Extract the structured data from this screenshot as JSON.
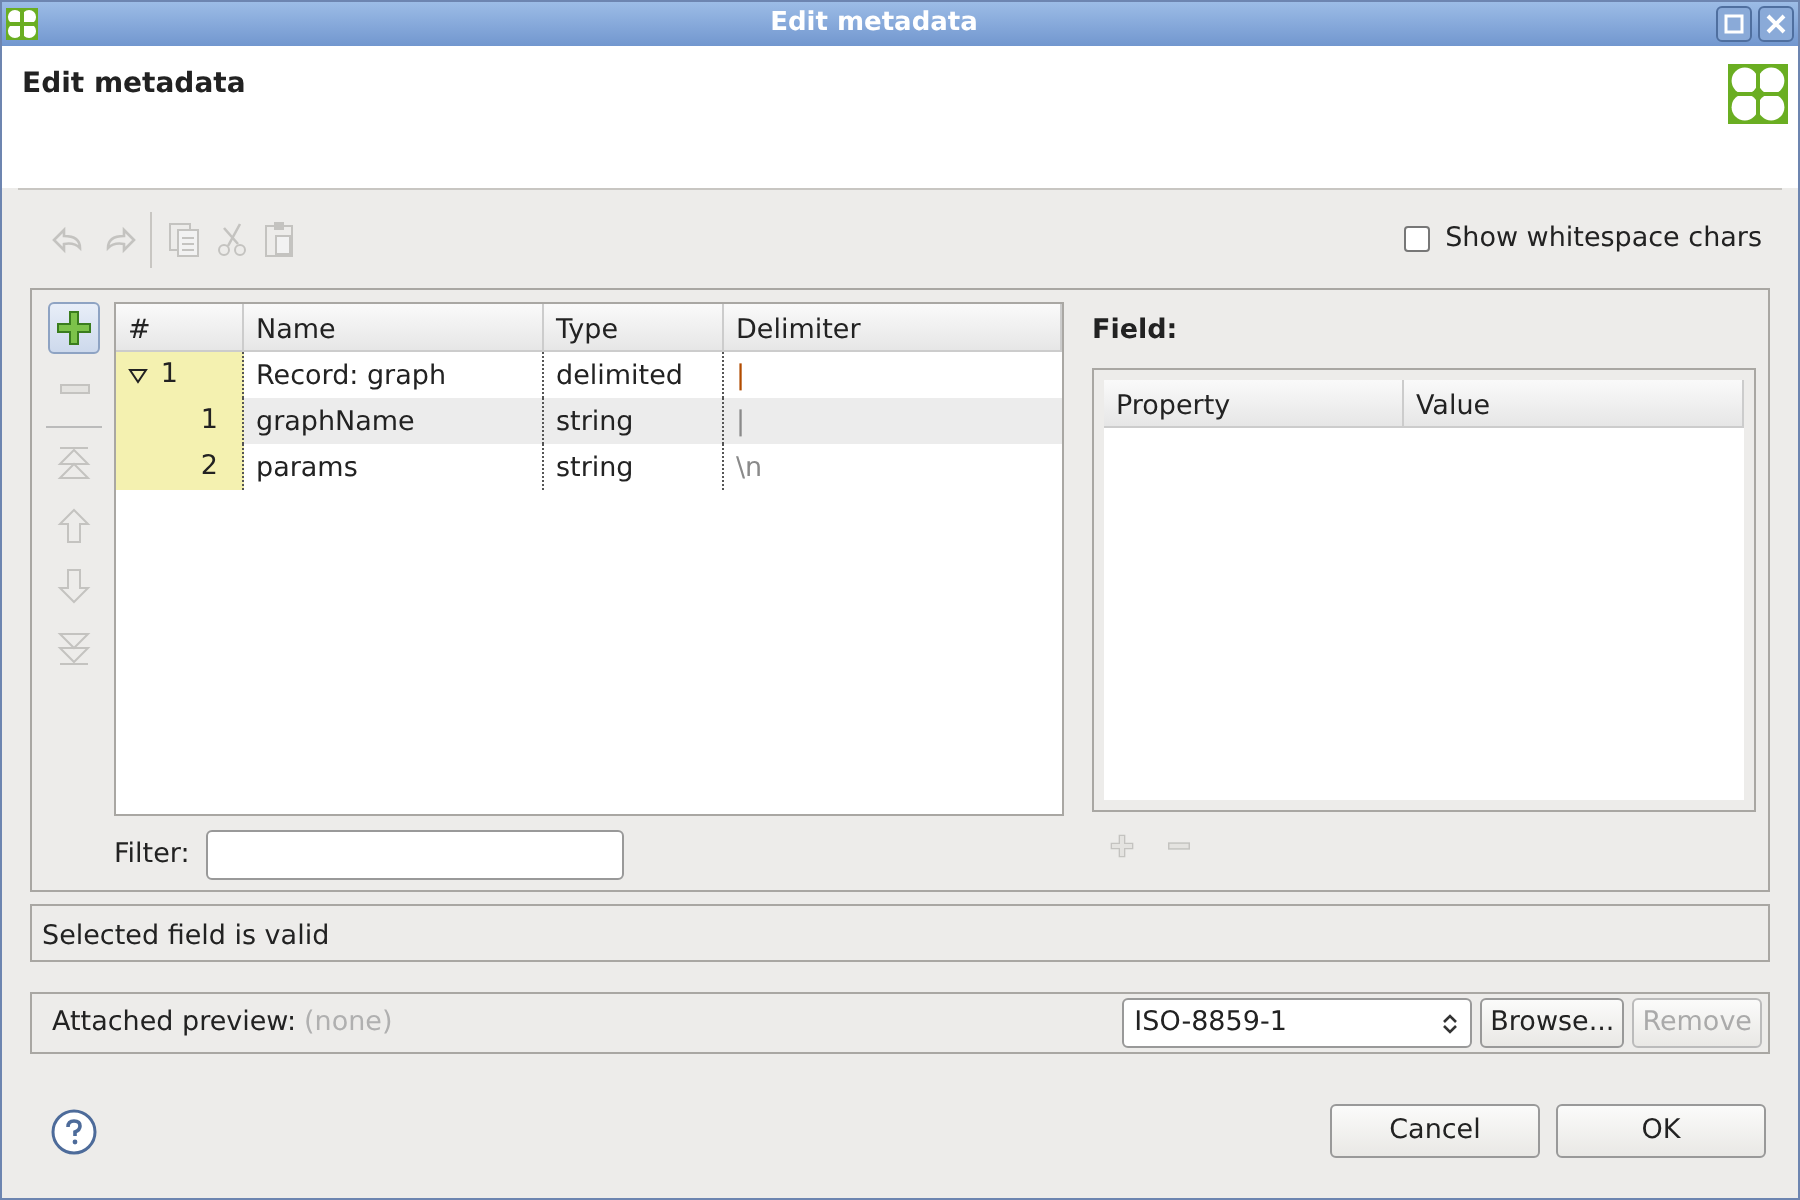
{
  "window": {
    "title": "Edit metadata"
  },
  "header": {
    "title": "Edit metadata"
  },
  "toolbar": [
    {
      "kind": "undo",
      "disabled": true
    },
    {
      "kind": "redo",
      "disabled": true
    },
    {
      "kind": "separator"
    },
    {
      "kind": "copy",
      "disabled": true
    },
    {
      "kind": "cut",
      "disabled": true
    },
    {
      "kind": "paste",
      "disabled": true
    }
  ],
  "show_whitespace": {
    "label": "Show whitespace chars",
    "checked": false
  },
  "side_buttons": [
    {
      "kind": "add",
      "disabled": false
    },
    {
      "kind": "remove",
      "disabled": true
    },
    {
      "kind": "separator"
    },
    {
      "kind": "top",
      "disabled": true
    },
    {
      "kind": "up",
      "disabled": true
    },
    {
      "kind": "down",
      "disabled": true
    },
    {
      "kind": "bottom",
      "disabled": true
    }
  ],
  "table": {
    "columns": [
      "#",
      "Name",
      "Type",
      "Delimiter"
    ],
    "rows": [
      {
        "kind": "record",
        "number": "1",
        "name": "Record: graph",
        "type": "delimited",
        "delimiter": "|",
        "expanded": true,
        "selected": false,
        "children": [
          {
            "kind": "field",
            "number": "1",
            "name": "graphName",
            "type": "string",
            "delimiter": "|",
            "selected": true
          },
          {
            "kind": "field",
            "number": "2",
            "name": "params",
            "type": "string",
            "delimiter": "\\n",
            "selected": false
          }
        ]
      }
    ]
  },
  "filter": {
    "label": "Filter:"
  },
  "field_panel": {
    "title": "Field:",
    "columns": [
      "Property",
      "Value"
    ],
    "buttons": [
      {
        "kind": "add",
        "disabled": true
      },
      {
        "kind": "remove",
        "disabled": true
      }
    ]
  },
  "status": "Selected field is valid",
  "preview": {
    "label": "Attached preview:",
    "value": "(none)",
    "encoding": "ISO-8859-1",
    "buttons": [
      {
        "label": "Browse...",
        "disabled": false
      },
      {
        "label": "Remove",
        "disabled": true
      }
    ]
  },
  "buttons": [
    {
      "label": "Cancel"
    },
    {
      "label": "OK"
    }
  ]
}
